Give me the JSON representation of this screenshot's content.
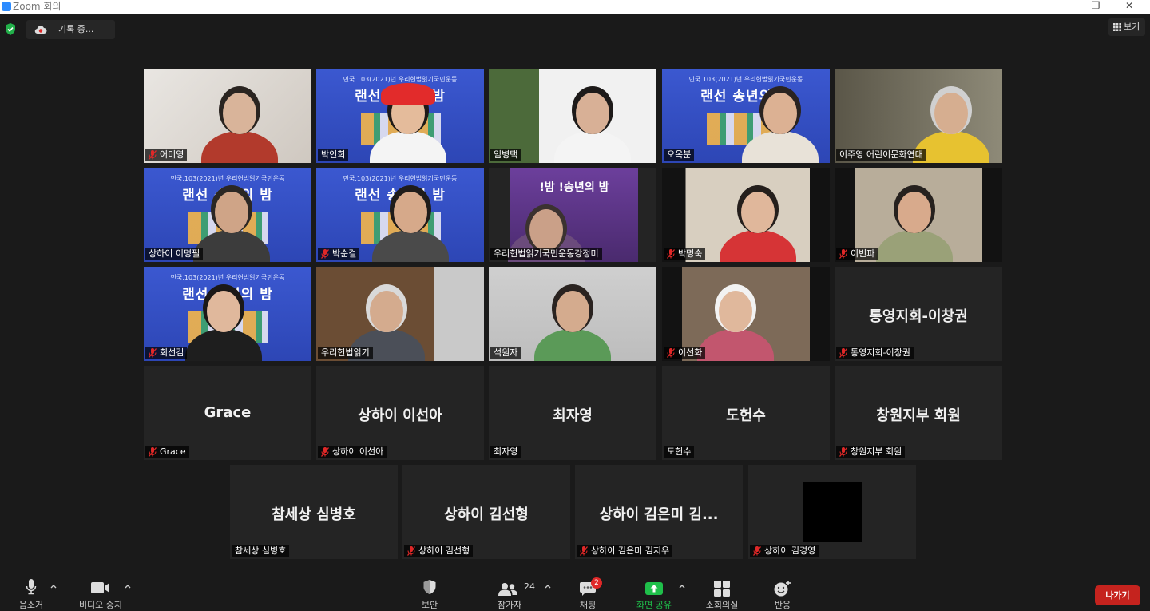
{
  "window": {
    "title": "Zoom 회의",
    "controls": [
      "minimize-icon",
      "restore-icon",
      "close-icon"
    ]
  },
  "topbar": {
    "recording_label": "기록 중...",
    "view_label": "보기"
  },
  "tiles": [
    {
      "name": "어미영",
      "video": true,
      "muted": true
    },
    {
      "name": "박인희",
      "video": true,
      "muted": false
    },
    {
      "name": "임병택",
      "video": true,
      "muted": false
    },
    {
      "name": "오옥분",
      "video": true,
      "muted": false
    },
    {
      "name": "이주영 어린이문화연대",
      "video": true,
      "muted": false
    },
    {
      "name": "상하이 이명필",
      "video": true,
      "muted": false
    },
    {
      "name": "박순걸",
      "video": true,
      "muted": true
    },
    {
      "name": "우리헌법읽기국민운동강정미",
      "video": true,
      "muted": false
    },
    {
      "name": "박명숙",
      "video": true,
      "muted": true
    },
    {
      "name": "이빈파",
      "video": true,
      "muted": true
    },
    {
      "name": "회선김",
      "video": true,
      "muted": true
    },
    {
      "name": "우리헌법읽기",
      "video": true,
      "muted": false
    },
    {
      "name": "석원자",
      "video": true,
      "muted": false,
      "active_speaker": true
    },
    {
      "name": "이선화",
      "video": true,
      "muted": true
    },
    {
      "name": "통영지회-이창권",
      "display": "통영지회-이창권",
      "video": false,
      "muted": true
    },
    {
      "name": "Grace",
      "display": "Grace",
      "video": false,
      "muted": true
    },
    {
      "name": "상하이 이선아",
      "display": "상하이 이선아",
      "video": false,
      "muted": true
    },
    {
      "name": "최자영",
      "display": "최자영",
      "video": false,
      "muted": false
    },
    {
      "name": "도헌수",
      "display": "도헌수",
      "video": false,
      "muted": false
    },
    {
      "name": "창원지부 회원",
      "display": "창원지부 회원",
      "video": false,
      "muted": true
    },
    {
      "name": "참세상 심병호",
      "display": "참세상 심병호",
      "video": false,
      "muted": false
    },
    {
      "name": "상하이 김선형",
      "display": "상하이 김선형",
      "video": false,
      "muted": true
    },
    {
      "name": "상하이 김은미 김지우",
      "display": "상하이 김은미 김...",
      "video": false,
      "muted": true
    },
    {
      "name": "상하이 김경영",
      "video": false,
      "muted": true,
      "black_avatar": true
    }
  ],
  "banner_text": {
    "subtitle": "민국.103(2021)년 우리헌법읽기국민운동",
    "title": "랜선 송년의 밤",
    "purple_title": "!밤 !송년의 밤"
  },
  "toolbar": {
    "audio_label": "음소거",
    "video_label": "비디오 중지",
    "security_label": "보안",
    "participants_label": "참가자",
    "participants_count": "24",
    "chat_label": "채팅",
    "chat_badge": "2",
    "share_label": "화면 공유",
    "breakout_label": "소회의실",
    "reactions_label": "반응",
    "leave_label": "나가기"
  },
  "colors": {
    "background": "#1a1a1a",
    "tile": "#242424",
    "active_border": "#e3ec8d",
    "share_green": "#1fbf4a",
    "leave_red": "#c5231e",
    "badge_red": "#e02828",
    "mute_red": "#e02828"
  }
}
